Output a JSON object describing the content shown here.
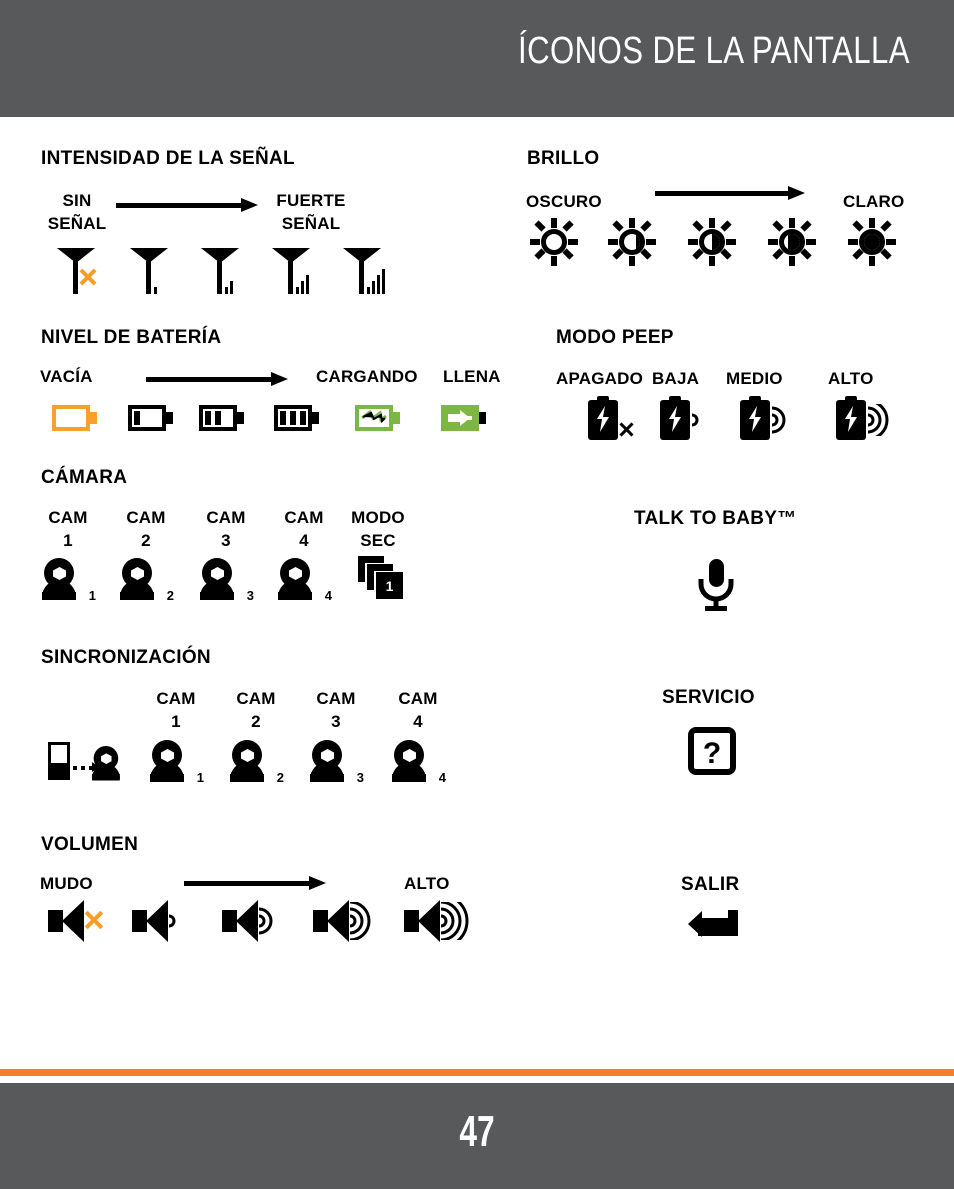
{
  "header": {
    "title": "ÍCONOS DE LA PANTALLA"
  },
  "footer": {
    "page_number": "47"
  },
  "colors": {
    "header_bg": "#58595b",
    "footer_bg": "#58595b",
    "accent_rule": "#f0802c",
    "orange_icon": "#f9a02c",
    "orange_x": "#f59d28",
    "green_icon": "#7cb742",
    "black": "#000000"
  },
  "sections": {
    "signal": {
      "title": "INTENSIDAD DE LA SEÑAL",
      "left_label": "SIN\nSEÑAL",
      "left_label_line1": "SIN",
      "left_label_line2": "SEÑAL",
      "right_label_line1": "FUERTE",
      "right_label_line2": "SEÑAL",
      "icons": [
        {
          "name": "signal-no-signal",
          "bars": 0,
          "x_mark": true
        },
        {
          "name": "signal-level-1",
          "bars": 1,
          "x_mark": false
        },
        {
          "name": "signal-level-2",
          "bars": 2,
          "x_mark": false
        },
        {
          "name": "signal-level-3",
          "bars": 3,
          "x_mark": false
        },
        {
          "name": "signal-level-4",
          "bars": 4,
          "x_mark": false
        }
      ]
    },
    "battery": {
      "title": "NIVEL DE BATERÍA",
      "left_label": "VACÍA",
      "mid_label": "CARGANDO",
      "right_label": "LLENA",
      "icons": [
        {
          "name": "battery-empty",
          "bars": 0,
          "style": "empty"
        },
        {
          "name": "battery-level-1",
          "bars": 1,
          "style": "black"
        },
        {
          "name": "battery-level-2",
          "bars": 2,
          "style": "black"
        },
        {
          "name": "battery-level-3",
          "bars": 3,
          "style": "black"
        },
        {
          "name": "battery-charging",
          "bars": 0,
          "style": "charging"
        },
        {
          "name": "battery-full-plug",
          "bars": 0,
          "style": "full"
        }
      ]
    },
    "camera": {
      "title": "CÁMARA",
      "items": [
        {
          "label_line1": "CAM",
          "label_line2": "1",
          "icon": "camera-1",
          "badge": "1"
        },
        {
          "label_line1": "CAM",
          "label_line2": "2",
          "icon": "camera-2",
          "badge": "2"
        },
        {
          "label_line1": "CAM",
          "label_line2": "3",
          "icon": "camera-3",
          "badge": "3"
        },
        {
          "label_line1": "CAM",
          "label_line2": "4",
          "icon": "camera-4",
          "badge": "4"
        },
        {
          "label_line1": "MODO",
          "label_line2": "SEC",
          "icon": "scan-mode",
          "badge": "1"
        }
      ]
    },
    "sync": {
      "title": "SINCRONIZACIÓN",
      "items": [
        {
          "label_line1": "",
          "label_line2": "",
          "icon": "pair-monitor-camera",
          "badge": ""
        },
        {
          "label_line1": "CAM",
          "label_line2": "1",
          "icon": "camera-1",
          "badge": "1"
        },
        {
          "label_line1": "CAM",
          "label_line2": "2",
          "icon": "camera-2",
          "badge": "2"
        },
        {
          "label_line1": "CAM",
          "label_line2": "3",
          "icon": "camera-3",
          "badge": "3"
        },
        {
          "label_line1": "CAM",
          "label_line2": "4",
          "icon": "camera-4",
          "badge": "4"
        }
      ]
    },
    "volume": {
      "title": "VOLUMEN",
      "left_label": "MUDO",
      "right_label": "ALTO",
      "icons": [
        {
          "name": "volume-mute",
          "waves": 0,
          "x_mark": true
        },
        {
          "name": "volume-level-1",
          "waves": 1,
          "x_mark": false
        },
        {
          "name": "volume-level-2",
          "waves": 2,
          "x_mark": false
        },
        {
          "name": "volume-level-3",
          "waves": 3,
          "x_mark": false
        },
        {
          "name": "volume-level-4",
          "waves": 4,
          "x_mark": false
        }
      ]
    },
    "brightness": {
      "title": "BRILLO",
      "left_label": "OSCURO",
      "right_label": "CLARO",
      "icons": [
        {
          "name": "brightness-level-1",
          "fill": 0
        },
        {
          "name": "brightness-level-2",
          "fill": 25
        },
        {
          "name": "brightness-level-3",
          "fill": 50
        },
        {
          "name": "brightness-level-4",
          "fill": 75
        },
        {
          "name": "brightness-level-5",
          "fill": 100
        }
      ]
    },
    "peep": {
      "title": "MODO PEEP",
      "items": [
        {
          "label": "APAGADO",
          "icon": "peep-off",
          "waves": 0,
          "x_mark": true
        },
        {
          "label": "BAJA",
          "icon": "peep-low",
          "waves": 1,
          "x_mark": false
        },
        {
          "label": "MEDIO",
          "icon": "peep-medium",
          "waves": 2,
          "x_mark": false
        },
        {
          "label": "ALTO",
          "icon": "peep-high",
          "waves": 3,
          "x_mark": false
        }
      ]
    },
    "talk": {
      "title": "TALK TO BABY™",
      "icon": "microphone"
    },
    "service": {
      "title": "SERVICIO",
      "icon": "question-mark-box"
    },
    "exit": {
      "title": "SALIR",
      "icon": "return-arrow"
    }
  }
}
